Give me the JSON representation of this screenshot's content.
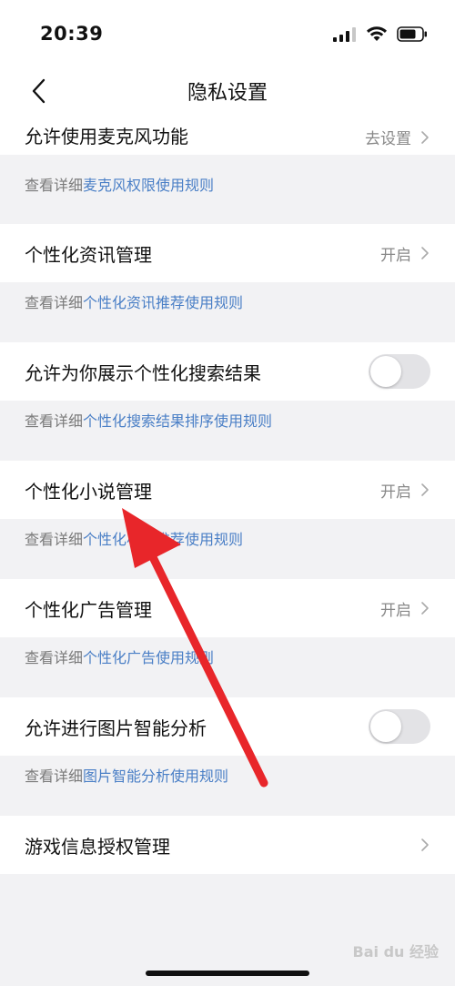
{
  "status_bar": {
    "time": "20:39"
  },
  "nav": {
    "title": "隐私设置"
  },
  "sections": {
    "microphone": {
      "label": "允许使用麦克风功能",
      "value": "去设置",
      "note_prefix": "查看详细",
      "note_link": "麦克风权限使用规则"
    },
    "news": {
      "label": "个性化资讯管理",
      "value": "开启",
      "note_prefix": "查看详细",
      "note_link": "个性化资讯推荐使用规则"
    },
    "search": {
      "label": "允许为你展示个性化搜索结果",
      "toggle_on": false,
      "note_prefix": "查看详细",
      "note_link": "个性化搜索结果排序使用规则"
    },
    "novel": {
      "label": "个性化小说管理",
      "value": "开启",
      "note_prefix": "查看详细",
      "note_link": "个性化小说推荐使用规则"
    },
    "ads": {
      "label": "个性化广告管理",
      "value": "开启",
      "note_prefix": "查看详细",
      "note_link": "个性化广告使用规则"
    },
    "image": {
      "label": "允许进行图片智能分析",
      "toggle_on": false,
      "note_prefix": "查看详细",
      "note_link": "图片智能分析使用规则"
    },
    "game": {
      "label": "游戏信息授权管理"
    }
  },
  "watermark": "Bai du 经验",
  "colors": {
    "link": "#4a7fc6",
    "arrow": "#e8262a",
    "toggle_off": "#e3e3e6"
  }
}
